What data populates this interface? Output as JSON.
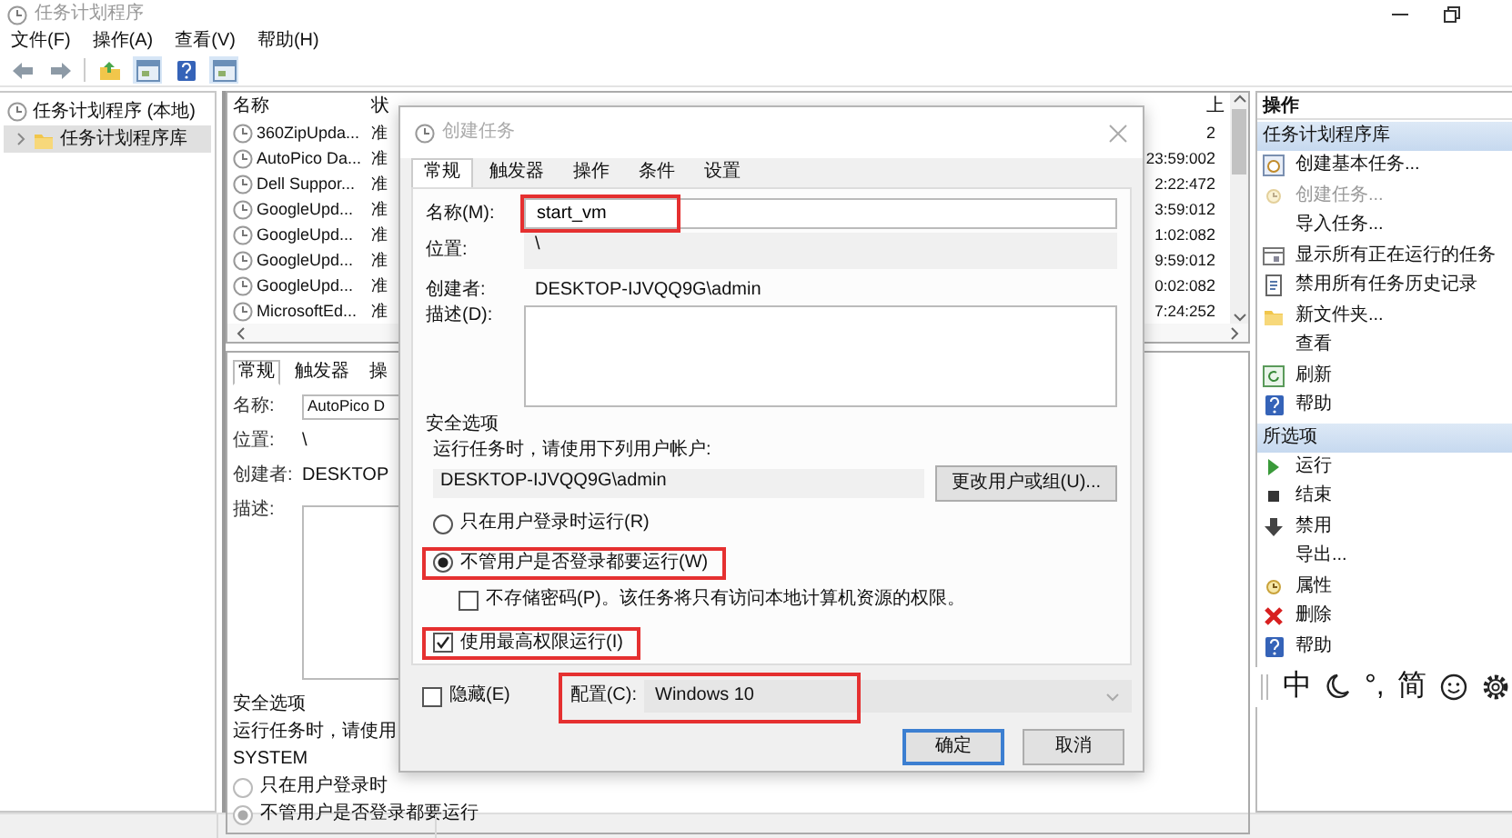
{
  "window": {
    "title": "任务计划程序"
  },
  "menu": [
    "文件(F)",
    "操作(A)",
    "查看(V)",
    "帮助(H)"
  ],
  "tree": [
    {
      "label": "任务计划程序 (本地)",
      "selected": false,
      "children": [
        {
          "label": "任务计划程序库",
          "selected": true,
          "expanded": false
        }
      ]
    }
  ],
  "task_table": {
    "columns": [
      "名称",
      "状",
      "上"
    ],
    "rows": [
      {
        "name": "360ZipUpda...",
        "status": "准",
        "column_5": "2"
      },
      {
        "name": "AutoPico Da...",
        "status": "准",
        "time": "23:59:00",
        "column_5": "2"
      },
      {
        "name": "Dell Suppor...",
        "status": "准",
        "time": "2:22:47",
        "column_5": "2"
      },
      {
        "name": "GoogleUpd...",
        "status": "准",
        "time": "3:59:01",
        "column_5": "2"
      },
      {
        "name": "GoogleUpd...",
        "status": "准",
        "time": "1:02:08",
        "column_5": "2"
      },
      {
        "name": "GoogleUpd...",
        "status": "准",
        "time": "9:59:01",
        "column_5": "2"
      },
      {
        "name": "GoogleUpd...",
        "status": "准",
        "time": "0:02:08",
        "column_5": "2"
      },
      {
        "name": "MicrosoftEd...",
        "status": "准",
        "time": "7:24:25",
        "column_5": "2"
      }
    ]
  },
  "details": {
    "tabs": [
      {
        "label": "常规",
        "selected": true
      },
      {
        "label": "触发器",
        "selected": false
      },
      {
        "label": "操",
        "selected": false
      }
    ],
    "name_label": "名称:",
    "name_value": "AutoPico D",
    "location_label": "位置:",
    "location_value": "\\",
    "author_label": "创建者:",
    "author_value": "DESKTOP",
    "description_label": "描述:",
    "security_title": "安全选项",
    "run_as_prompt": "运行任务时，请使用",
    "account": "SYSTEM",
    "run_options": [
      {
        "label": "只在用户登录时",
        "selected": false
      },
      {
        "label": "不管用户是否登录都要运行",
        "selected": true
      }
    ]
  },
  "dialog": {
    "title": "创建任务",
    "tabs": [
      {
        "label": "常规",
        "selected": true
      },
      {
        "label": "触发器",
        "selected": false
      },
      {
        "label": "操作",
        "selected": false
      },
      {
        "label": "条件",
        "selected": false
      },
      {
        "label": "设置",
        "selected": false
      }
    ],
    "name": {
      "label": "名称(M):",
      "value": "start_vm",
      "highlighted": true
    },
    "location": {
      "label": "位置:",
      "value": "\\"
    },
    "author": {
      "label": "创建者:",
      "value": "DESKTOP-IJVQQ9G\\admin"
    },
    "description": {
      "label": "描述(D):"
    },
    "security": {
      "title": "安全选项",
      "prompt": "运行任务时，请使用下列用户帐户:",
      "account": "DESKTOP-IJVQQ9G\\admin",
      "change_button": "更改用户或组(U)...",
      "run_options": [
        {
          "label": "只在用户登录时运行(R)",
          "selected": false,
          "highlighted": false
        },
        {
          "label": "不管用户是否登录都要运行(W)",
          "selected": true,
          "highlighted": true
        }
      ],
      "no_password": {
        "label": "不存储密码(P)。该任务将只有访问本地计算机资源的权限。",
        "checked": false
      },
      "highest_privileges": {
        "label": "使用最高权限运行(I)",
        "checked": true,
        "highlighted": true
      }
    },
    "hidden": {
      "label": "隐藏(E)",
      "checked": false
    },
    "configure": {
      "label": "配置(C):",
      "value": "Windows 10",
      "highlighted": true
    },
    "buttons": [
      {
        "label": "确定",
        "default": true
      },
      {
        "label": "取消",
        "default": false
      }
    ]
  },
  "actions": {
    "title": "操作",
    "sections": [
      {
        "title": "任务计划程序库",
        "items": [
          {
            "label": "创建基本任务...",
            "disabled": false
          },
          {
            "label": "创建任务...",
            "disabled": true
          },
          {
            "label": "导入任务...",
            "disabled": false
          },
          {
            "label": "显示所有正在运行的任务",
            "disabled": false
          },
          {
            "label": "禁用所有任务历史记录",
            "disabled": false
          },
          {
            "label": "新文件夹...",
            "disabled": false
          },
          {
            "label": "查看",
            "disabled": false
          },
          {
            "label": "刷新",
            "disabled": false
          },
          {
            "label": "帮助",
            "disabled": false
          }
        ]
      },
      {
        "title": "所选项",
        "items": [
          {
            "label": "运行",
            "disabled": false
          },
          {
            "label": "结束",
            "disabled": false
          },
          {
            "label": "禁用",
            "disabled": false
          },
          {
            "label": "导出...",
            "disabled": false
          },
          {
            "label": "属性",
            "disabled": false
          },
          {
            "label": "删除",
            "disabled": false
          },
          {
            "label": "帮助",
            "disabled": false
          }
        ]
      }
    ]
  },
  "ime_bar": {
    "mode": "中",
    "punctuation": "°,",
    "script": "简"
  }
}
